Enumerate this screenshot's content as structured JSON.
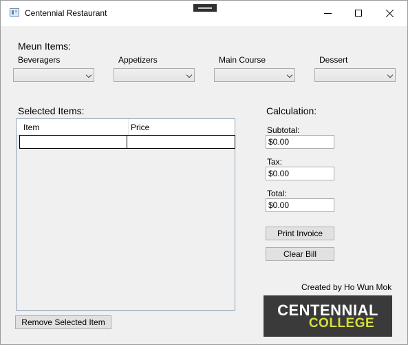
{
  "window": {
    "title": "Centennial Restaurant"
  },
  "menu": {
    "heading": "Meun Items:",
    "categories": [
      {
        "label": "Beveragers",
        "selected": ""
      },
      {
        "label": "Appetizers",
        "selected": ""
      },
      {
        "label": "Main Course",
        "selected": ""
      },
      {
        "label": "Dessert",
        "selected": ""
      }
    ]
  },
  "selected": {
    "heading": "Selected Items:",
    "columns": [
      "Item",
      "Price"
    ],
    "rows": [
      [
        "",
        ""
      ]
    ],
    "remove_label": "Remove Selected Item"
  },
  "calculation": {
    "heading": "Calculation:",
    "subtotal_label": "Subtotal:",
    "subtotal_value": "$0.00",
    "tax_label": "Tax:",
    "tax_value": "$0.00",
    "total_label": "Total:",
    "total_value": "$0.00",
    "print_label": "Print Invoice",
    "clear_label": "Clear Bill"
  },
  "footer": {
    "credit": "Created by Ho Wun Mok",
    "logo_line1": "CENTENNIAL",
    "logo_line2": "COLLEGE"
  },
  "colors": {
    "logo_bg": "#3a3a3a",
    "logo_accent": "#d6e038"
  }
}
